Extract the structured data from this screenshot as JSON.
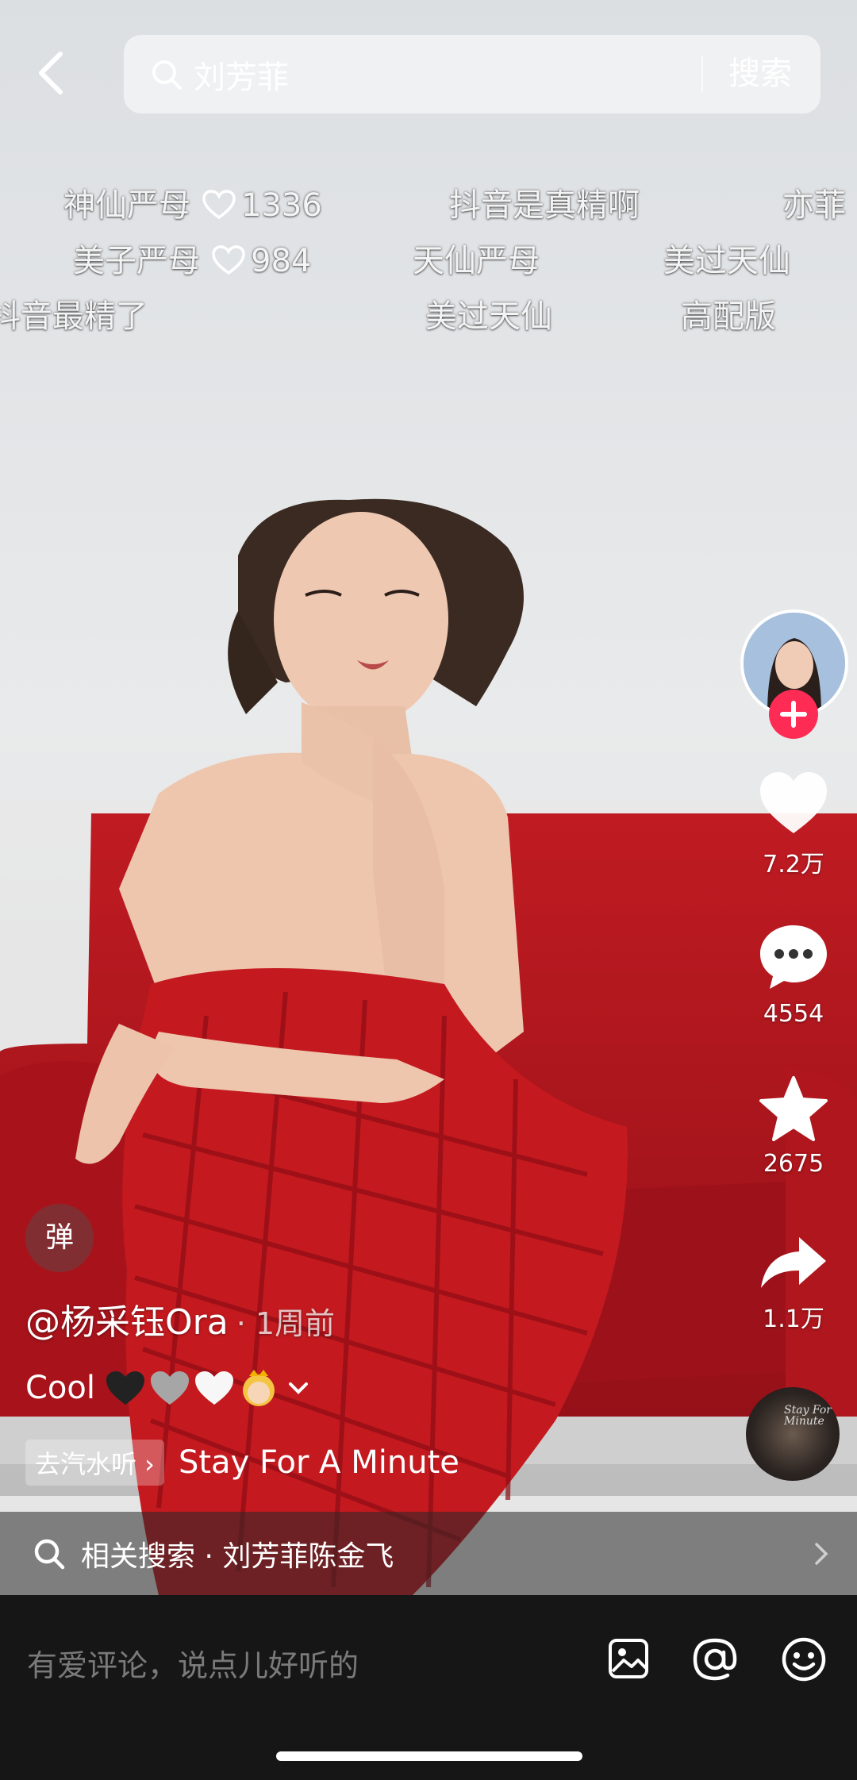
{
  "search": {
    "query": "刘芳菲",
    "button": "搜索"
  },
  "danmaku": {
    "r1a": "神仙严母",
    "r1a_likes": "1336",
    "r1b": "抖音是真精啊",
    "r1c": "亦菲",
    "r2a": "美子严母",
    "r2a_likes": "984",
    "r2b": "天仙严母",
    "r2c": "美过天仙",
    "r3a": "抖音最精了",
    "r3b": "美过天仙",
    "r3c": "高配版"
  },
  "actions": {
    "likes": "7.2万",
    "comments": "4554",
    "favorites": "2675",
    "shares": "1.1万"
  },
  "music_cover_text": "Stay For Minute",
  "danmu_toggle": "弹",
  "post": {
    "author": "@杨采钰Ora",
    "time": "· 1周前",
    "caption": "Cool"
  },
  "music": {
    "tag": "去汽水听 ›",
    "song": "Stay For A Minute"
  },
  "related": {
    "text": "相关搜索 · 刘芳菲陈金飞"
  },
  "comment": {
    "placeholder": "有爱评论，说点儿好听的"
  },
  "colors": {
    "accent": "#fe2c55",
    "sofa": "#b3151c",
    "dress": "#c41a1f"
  }
}
